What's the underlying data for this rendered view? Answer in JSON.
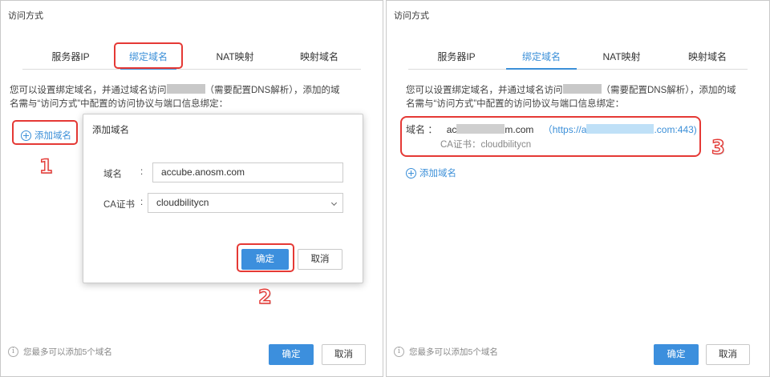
{
  "left": {
    "title": "访问方式",
    "tabs": [
      "服务器IP",
      "绑定域名",
      "NAT映射",
      "映射域名"
    ],
    "active_tab": 1,
    "desc_line1_a": "您可以设置绑定域名，并通过域名访问",
    "desc_line1_b": "（需要配置DNS解析），添加的域",
    "desc_line2": "名需与“访问方式”中配置的访问协议与端口信息绑定：",
    "add_domain": "添加域名",
    "footer_note": "您最多可以添加5个域名",
    "ok": "确定",
    "cancel": "取消",
    "marker1": "1",
    "marker2": "2",
    "dialog": {
      "title": "添加域名",
      "domain_label": "域名",
      "domain_value": "accube.anosm.com",
      "ca_label": "CA证书",
      "ca_value": "cloudbilitycn",
      "colon": ":",
      "ok": "确定",
      "cancel": "取消"
    }
  },
  "right": {
    "title": "访问方式",
    "tabs": [
      "服务器IP",
      "绑定域名",
      "NAT映射",
      "映射域名"
    ],
    "active_tab": 1,
    "desc_line1_a": "您可以设置绑定域名，并通过域名访问",
    "desc_line1_b": "（需要配置DNS解析），添加的域",
    "desc_line2": "名需与“访问方式”中配置的访问协议与端口信息绑定：",
    "domain_label": "域名  ：",
    "domain_prefix": "ac",
    "domain_suffix": "m.com",
    "link_prefix": "（https://",
    "link_mid": "a",
    "link_suffix": ".com:443)",
    "ca_line": "CA证书：cloudbilitycn",
    "marker3": "3",
    "add_domain": "添加域名",
    "footer_note": "您最多可以添加5个域名",
    "ok": "确定",
    "cancel": "取消"
  },
  "colors": {
    "accent": "#3b8fd8",
    "primary_button": "#3c8fdd",
    "annotation_red": "#e53935"
  }
}
